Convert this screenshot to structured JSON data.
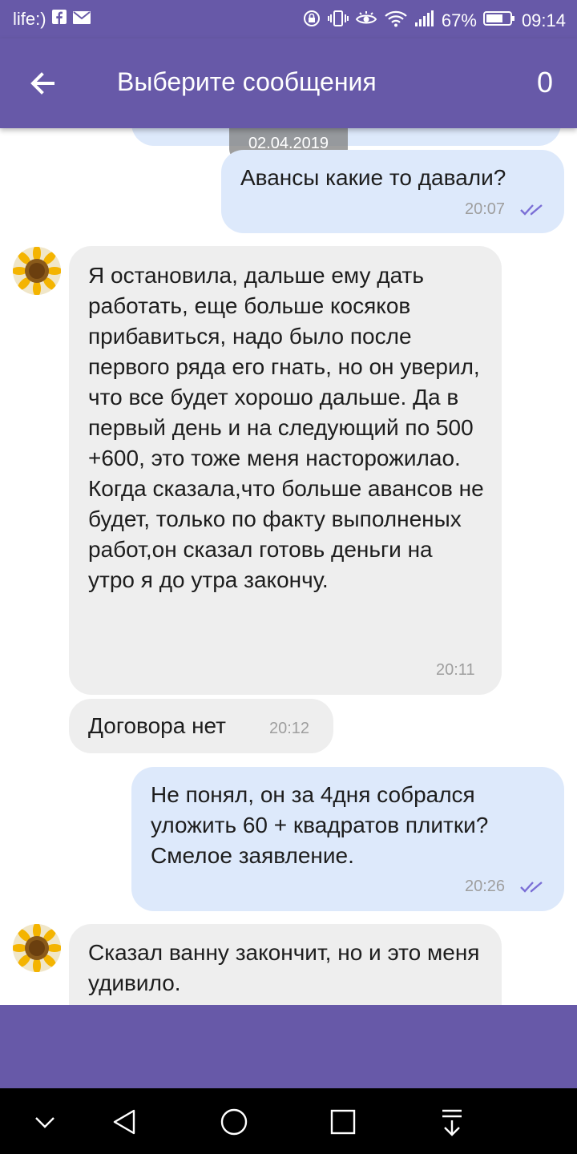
{
  "status_bar": {
    "carrier": "life:)",
    "battery": "67%",
    "time": "09:14",
    "icons": [
      "facebook-icon",
      "mail-icon",
      "rotation-lock-icon",
      "vibrate-icon",
      "eye-icon",
      "wifi-icon",
      "signal-icon",
      "battery-icon"
    ]
  },
  "header": {
    "back_icon": "arrow-left-icon",
    "title": "Выберите сообщения",
    "selected_count": "0"
  },
  "colors": {
    "brand": "#6759a8",
    "outgoing_bubble": "#dde9fb",
    "incoming_bubble": "#eeeeee",
    "read_checks": "#7b6fd6"
  },
  "chat": {
    "date_chip": "02.04.2019",
    "messages": [
      {
        "direction": "out",
        "text": "Авансы какие то давали?",
        "time": "20:07",
        "status": "read"
      },
      {
        "direction": "in",
        "text": "Я остановила, дальше ему дать работать, еще больше косяков прибавиться, надо было после первого ряда его гнать, но он уверил, что все будет хорошо дальше. Да в первый день и на следующий по 500 +600, это тоже меня насторожилао. Когда сказала,что больше авансов не будет, только по факту выполненых работ,он сказал готовь деньги на утро я до утра закончу.",
        "time": "20:11"
      },
      {
        "direction": "in",
        "text": "Договора нет",
        "time": "20:12"
      },
      {
        "direction": "out",
        "text": "Не понял, он за 4дня собрался уложить 60 + квадратов плитки? Смелое заявление.",
        "time": "20:26",
        "status": "read"
      },
      {
        "direction": "in",
        "text": "Сказал ванну закончит, но и это меня удивило.",
        "time": ""
      }
    ]
  },
  "nav_bar": {
    "icons": [
      "chevron-down-icon",
      "back-triangle-icon",
      "home-circle-icon",
      "recents-square-icon",
      "notification-pull-icon"
    ]
  }
}
